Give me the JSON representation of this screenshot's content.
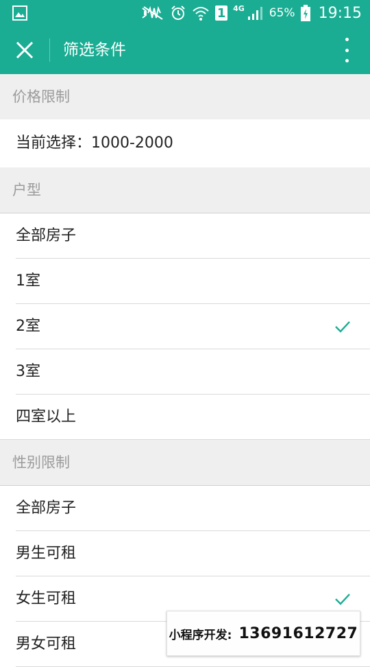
{
  "status_bar": {
    "network": "4G",
    "sim_slot": "1",
    "battery_percent": "65%",
    "time": "19:15",
    "icons": [
      "image-icon",
      "mute-icon",
      "alarm-icon",
      "wifi-icon",
      "sim-icon",
      "signal-icon",
      "battery-icon"
    ]
  },
  "toolbar": {
    "title": "筛选条件",
    "close_icon": "close-icon",
    "more_icon": "more-vertical-icon"
  },
  "price": {
    "section_title": "价格限制",
    "current_selection": "当前选择：1000-2000"
  },
  "room_type": {
    "section_title": "户型",
    "options": [
      {
        "label": "全部房子",
        "selected": false
      },
      {
        "label": "1室",
        "selected": false
      },
      {
        "label": "2室",
        "selected": true
      },
      {
        "label": "3室",
        "selected": false
      },
      {
        "label": "四室以上",
        "selected": false
      }
    ]
  },
  "gender": {
    "section_title": "性别限制",
    "options": [
      {
        "label": "全部房子",
        "selected": false
      },
      {
        "label": "男生可租",
        "selected": false
      },
      {
        "label": "女生可租",
        "selected": true
      },
      {
        "label": "男女可租",
        "selected": false
      }
    ]
  },
  "watermark": {
    "label": "小程序开发:",
    "phone": "13691612727"
  },
  "colors": {
    "accent": "#1aad93",
    "section_bg": "#efefef",
    "divider": "#d9d9d9",
    "check": "#1aad93"
  }
}
